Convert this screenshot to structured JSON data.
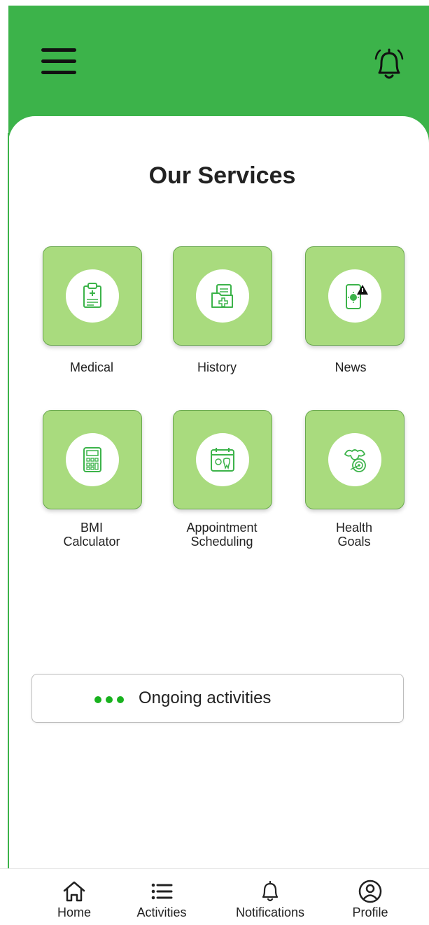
{
  "header": {
    "menu_icon": "hamburger-menu-icon",
    "bell_icon": "bell-icon",
    "color": "#3cb34a"
  },
  "page_title": "Our Services",
  "services": [
    {
      "label": "Medical",
      "icon": "clipboard-icon"
    },
    {
      "label": "History",
      "icon": "folder-medical-icon"
    },
    {
      "label": "News",
      "icon": "phone-alert-icon"
    },
    {
      "label_line1": "BMI",
      "label_line2": "Calculator",
      "icon": "calculator-icon"
    },
    {
      "label_line1": "Appointment",
      "label_line2": "Scheduling",
      "icon": "calendar-tooth-icon"
    },
    {
      "label_line1": "Health",
      "label_line2": "Goals",
      "icon": "muscle-target-icon"
    }
  ],
  "ongoing": {
    "label": "Ongoing activities",
    "dots_color": "#18b21e"
  },
  "bottom_nav": [
    {
      "label": "Home",
      "icon": "home-icon"
    },
    {
      "label": "Activities",
      "icon": "list-icon"
    },
    {
      "label": "Notifications",
      "icon": "bell-icon"
    },
    {
      "label": "Profile",
      "icon": "profile-icon"
    }
  ],
  "colors": {
    "tile": "#a9db7e",
    "tile_border": "#6aa84f",
    "accent": "#3cb34a"
  }
}
